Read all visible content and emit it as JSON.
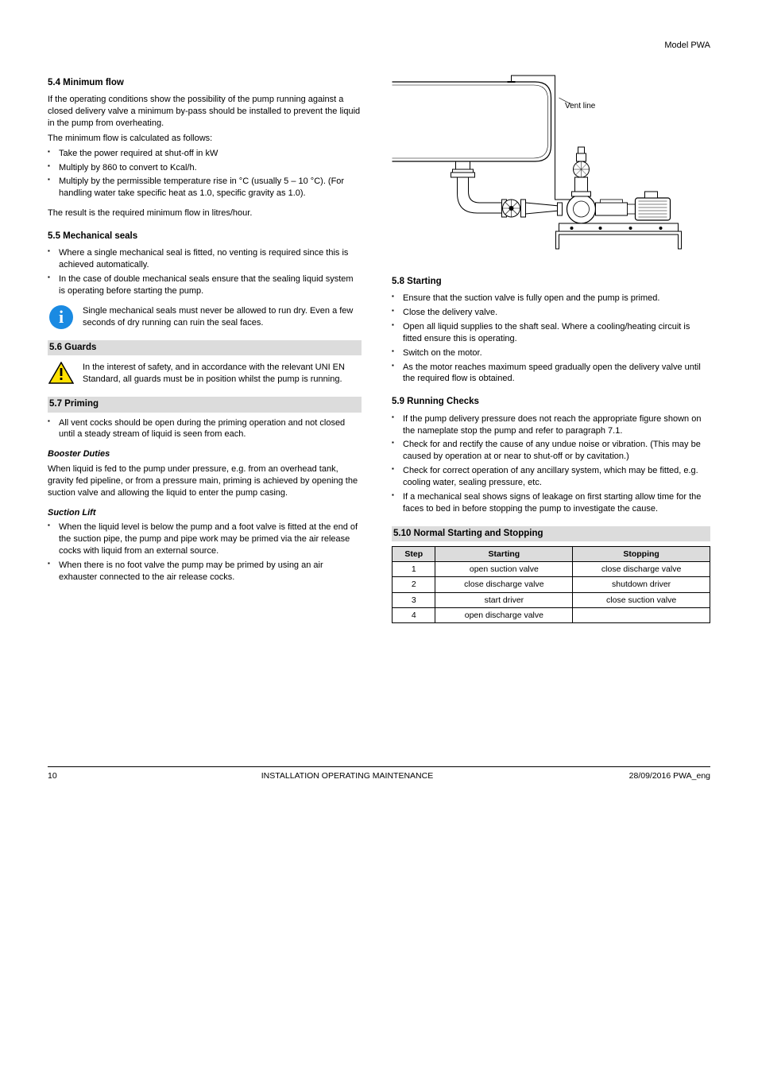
{
  "header": {
    "series_label": "Model PWA"
  },
  "left": {
    "s1": {
      "title": "5.4 Minimum flow",
      "p1": "If the operating conditions show the possibility of the pump running against a closed delivery valve a minimum by-pass should be installed to prevent the liquid in the pump from overheating.",
      "p2": "The minimum flow is calculated as follows:",
      "bullets1": [
        "Take the power required at shut-off in kW",
        "Multiply by 860 to convert to Kcal/h.",
        "Multiply by the permissible temperature rise in °C (usually 5 – 10 °C). (For handling water take specific heat as 1.0, specific gravity as 1.0)."
      ],
      "p3": "The result is the required minimum flow in litres/hour."
    },
    "s2": {
      "title": "5.5 Mechanical seals",
      "bullets": [
        "Where a single mechanical seal is fitted, no venting is required since this is achieved automatically.",
        "In the case of double mechanical seals ensure that the sealing liquid system is operating before starting the pump."
      ]
    },
    "info_text": "Single mechanical seals must never be allowed to run dry. Even a few seconds of dry running can ruin the seal faces.",
    "s3": {
      "title": "5.6 Guards",
      "warn_text": "In the interest of safety, and in accordance with the relevant UNI EN Standard, all guards must be in position whilst the pump is running.",
      "title2": "5.7 Priming",
      "bullets2": [
        "All vent cocks should be open during the priming operation and not closed until a steady stream of liquid is seen from each."
      ],
      "sub1_title": "Booster Duties",
      "sub1_text": "When liquid is fed to the pump under pressure, e.g. from an overhead tank, gravity fed pipeline, or from a pressure main, priming is achieved by opening the suction valve and allowing the liquid to enter the pump casing.",
      "sub2_title": "Suction Lift",
      "sub2_bullets": [
        "When the liquid level is below the pump and a foot valve is fitted at the end of the suction pipe, the pump and pipe work may be primed via the air release cocks with liquid from an external source.",
        "When there is no foot valve the pump may be primed by using an air exhauster connected to the air release cocks."
      ]
    }
  },
  "right": {
    "fig_vent": "Vent line",
    "s4": {
      "title": "5.8 Starting",
      "bullets": [
        "Ensure that the suction valve is fully open and the pump is primed.",
        "Close the delivery valve.",
        "Open all liquid supplies to the shaft seal. Where a cooling/heating circuit is fitted ensure this is operating.",
        "Switch on the motor.",
        "As the motor reaches maximum speed gradually open the delivery valve until the required flow is obtained."
      ]
    },
    "s5": {
      "title": "5.9 Running Checks",
      "bullets": [
        "If the pump delivery pressure does not reach the appropriate figure shown on the nameplate stop the pump and refer to paragraph 7.1.",
        "Check for and rectify the cause of any undue noise or vibration. (This may be caused by operation at or near to shut-off or by cavitation.)",
        "Check for correct operation of any ancillary system, which may be fitted, e.g. cooling water, sealing pressure, etc.",
        "If a mechanical seal shows signs of leakage on first starting allow time for the faces to bed in before stopping the pump to investigate the cause."
      ]
    },
    "s6": {
      "title": "5.10 Normal Starting and Stopping",
      "table": {
        "headers": [
          "Step",
          "Starting",
          "Stopping"
        ],
        "rows": [
          [
            "1",
            "open suction valve",
            "close discharge valve"
          ],
          [
            "2",
            "close discharge valve",
            "shutdown driver"
          ],
          [
            "3",
            "start driver",
            "close suction valve"
          ],
          [
            "4",
            "open discharge valve",
            ""
          ]
        ]
      }
    }
  },
  "footer": {
    "page": "10",
    "center": "INSTALLATION  OPERATING  MAINTENANCE",
    "right": "28/09/2016  PWA_eng"
  }
}
